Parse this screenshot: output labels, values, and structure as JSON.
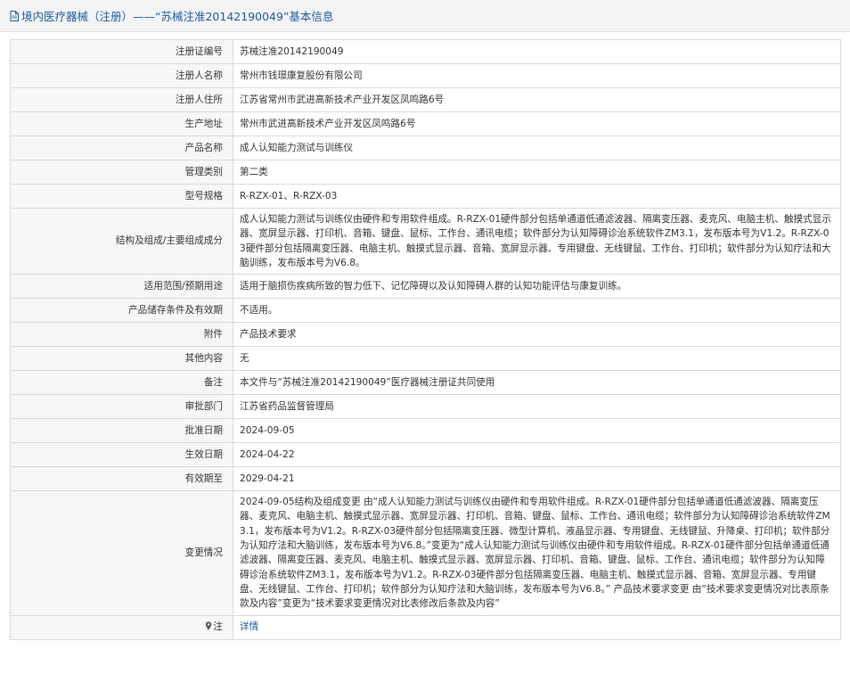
{
  "header": {
    "title": "境内医疗器械（注册）——“苏械注准20142190049”基本信息"
  },
  "rows": [
    {
      "label": "注册证编号",
      "value": "苏械注准20142190049"
    },
    {
      "label": "注册人名称",
      "value": "常州市钱璟康复股份有限公司"
    },
    {
      "label": "注册人住所",
      "value": "江苏省常州市武进高新技术产业开发区凤鸣路6号"
    },
    {
      "label": "生产地址",
      "value": "常州市武进高新技术产业开发区凤鸣路6号"
    },
    {
      "label": "产品名称",
      "value": "成人认知能力测试与训练仪"
    },
    {
      "label": "管理类别",
      "value": "第二类"
    },
    {
      "label": "型号规格",
      "value": "R-RZX-01、R-RZX-03"
    },
    {
      "label": "结构及组成/主要组成成分",
      "value": "成人认知能力测试与训练仪由硬件和专用软件组成。R-RZX-01硬件部分包括单通道低通滤波器、隔离变压器、麦克风、电脑主机、触摸式显示器、宽屏显示器、打印机、音箱、键盘、鼠标、工作台、通讯电缆；软件部分为认知障碍诊治系统软件ZM3.1，发布版本号为V1.2。R-RZX-03硬件部分包括隔离变压器、电脑主机、触摸式显示器、音箱、宽屏显示器、专用键盘、无线键鼠、工作台、打印机；软件部分为认知疗法和大脑训练，发布版本号为V6.8。"
    },
    {
      "label": "适用范围/预期用途",
      "value": "适用于脑损伤疾病所致的智力低下、记忆障碍以及认知障碍人群的认知功能评估与康复训练。"
    },
    {
      "label": "产品储存条件及有效期",
      "value": "不适用。"
    },
    {
      "label": "附件",
      "value": "产品技术要求"
    },
    {
      "label": "其他内容",
      "value": "无"
    },
    {
      "label": "备注",
      "value": "本文件与“苏械注准20142190049”医疗器械注册证共同使用"
    },
    {
      "label": "审批部门",
      "value": "江苏省药品监督管理局"
    },
    {
      "label": "批准日期",
      "value": "2024-09-05"
    },
    {
      "label": "生效日期",
      "value": "2024-04-22"
    },
    {
      "label": "有效期至",
      "value": "2029-04-21"
    },
    {
      "label": "变更情况",
      "value": "2024-09-05结构及组成变更 由“成人认知能力测试与训练仪由硬件和专用软件组成。R-RZX-01硬件部分包括单通道低通滤波器、隔离变压器、麦克风、电脑主机、触摸式显示器、宽屏显示器、打印机、音箱、键盘、鼠标、工作台、通讯电缆；软件部分为认知障碍诊治系统软件ZM3.1，发布版本号为V1.2。R-RZX-03硬件部分包括隔离变压器、微型计算机、液晶显示器、专用键盘、无线键鼠、升降桌、打印机；软件部分为认知疗法和大脑训练，发布版本号为V6.8。”变更为“成人认知能力测试与训练仪由硬件和专用软件组成。R-RZX-01硬件部分包括单通道低通滤波器、隔离变压器、麦克风、电脑主机、触摸式显示器、宽屏显示器、打印机、音箱、键盘、鼠标、工作台、通讯电缆；软件部分为认知障碍诊治系统软件ZM3.1，发布版本号为V1.2。R-RZX-03硬件部分包括隔离变压器、电脑主机、触摸式显示器、音箱、宽屏显示器、专用键盘、无线键鼠、工作台、打印机；软件部分为认知疗法和大脑训练，发布版本号为V6.8。” 产品技术要求变更 由“技术要求变更情况对比表原条款及内容”变更为“技术要求变更情况对比表修改后条款及内容”"
    }
  ],
  "footer_row": {
    "label": "注",
    "link": "详情"
  }
}
